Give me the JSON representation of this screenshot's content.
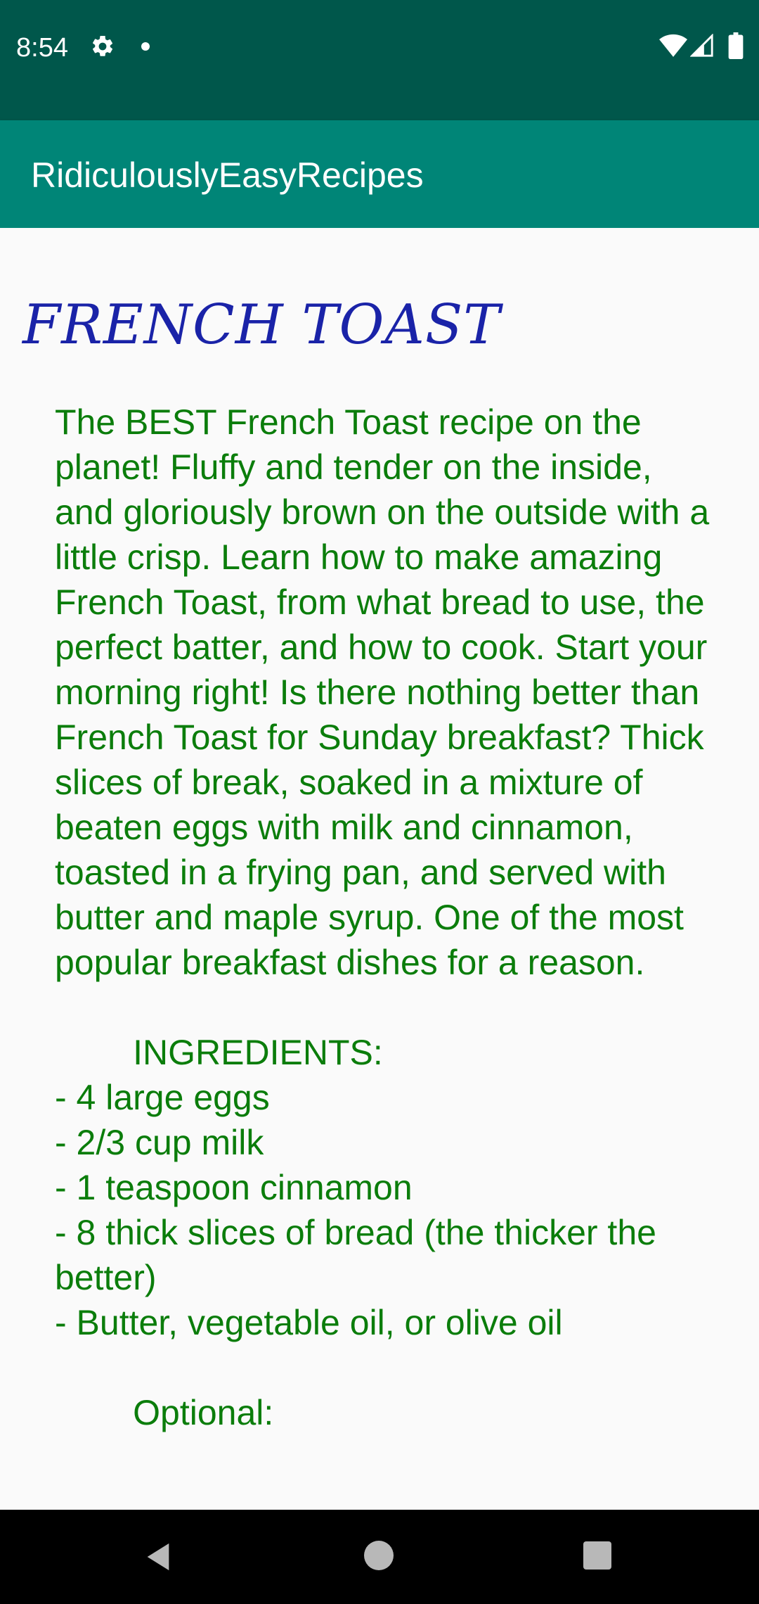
{
  "status_bar": {
    "time": "8:54",
    "icons": [
      "gear-icon",
      "notification-dot-icon",
      "wifi-icon",
      "signal-icon",
      "battery-icon"
    ]
  },
  "app_bar": {
    "title": "RidiculouslyEasyRecipes"
  },
  "recipe": {
    "title": "FRENCH TOAST",
    "body": "The BEST French Toast recipe on the planet! Fluffy and tender on the inside, and gloriously brown on the outside with a little crisp. Learn how to make amazing French Toast, from what bread to use, the perfect batter, and how to cook. Start your morning right! Is there nothing better than French Toast for Sunday breakfast? Thick slices of break, soaked in a mixture of beaten eggs with milk and cinnamon, toasted in a frying pan, and served with butter and maple syrup. One of the most popular breakfast dishes for a reason.\n\n        INGREDIENTS:\n- 4 large eggs\n- 2/3 cup milk\n- 1 teaspoon cinnamon\n- 8 thick slices of bread (the thicker the better)\n- Butter, vegetable oil, or olive oil\n\n        Optional:"
  },
  "colors": {
    "status_bar": "#00574b",
    "app_bar": "#008577",
    "title_text": "#1a23a8",
    "body_text": "#0b7d0b",
    "background": "#fafafa",
    "nav_bar": "#000000"
  },
  "nav_bar": {
    "buttons": [
      "back-icon",
      "home-icon",
      "recents-icon"
    ]
  }
}
